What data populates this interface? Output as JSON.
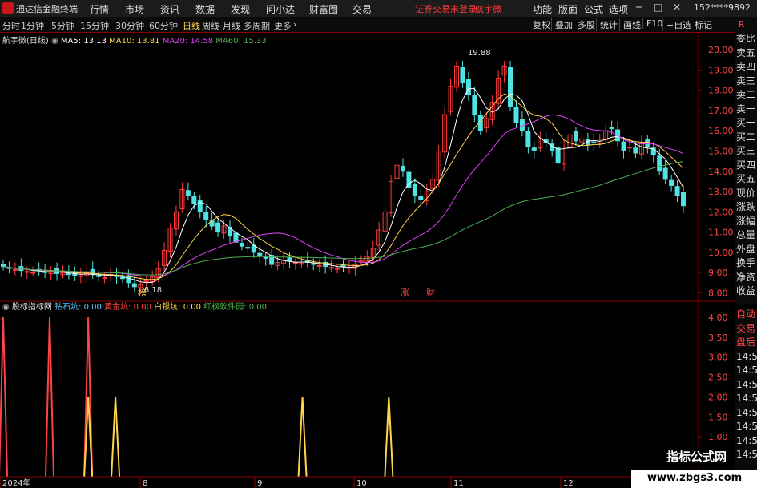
{
  "app": {
    "name": "通达信金融终端"
  },
  "menu": [
    "行情",
    "市场",
    "资讯",
    "数据",
    "发现",
    "问小达",
    "财富圈",
    "交易"
  ],
  "status": {
    "warning": "证券交易未登录",
    "stock_short": "航宇微"
  },
  "right_menu": [
    "功能",
    "版面",
    "公式",
    "选项"
  ],
  "account": "152****9892",
  "periods": [
    "分时",
    "1分钟",
    "5分钟",
    "15分钟",
    "30分钟",
    "60分钟",
    "日线",
    "周线",
    "月线",
    "多周期",
    "更多"
  ],
  "active_period": "日线",
  "tools": [
    "复权",
    "叠加",
    "多股",
    "统计",
    "画线",
    "F10",
    "+自选",
    "标记"
  ],
  "main": {
    "title": "航宇微(日线)",
    "ma": [
      {
        "label": "MA5: 13.13",
        "color": "#ffffff"
      },
      {
        "label": "MA10: 13.81",
        "color": "#ffd54a"
      },
      {
        "label": "MA20: 14.58",
        "color": "#e040fb"
      },
      {
        "label": "MA60: 15.33",
        "color": "#4caf50"
      }
    ],
    "high_label": "19.88",
    "low_label": "8.18",
    "markers": [
      "榜",
      "涨",
      "财"
    ]
  },
  "indicator": {
    "title": "股标指标网",
    "items": [
      {
        "label": "钻石坑: 0.00",
        "color": "#4fc3f7"
      },
      {
        "label": "黄金坑: 0.00",
        "color": "#ff4444"
      },
      {
        "label": "白银坑: 0.00",
        "color": "#ffd54a"
      },
      {
        "label": "红枫软件园: 0.00",
        "color": "#4caf50"
      }
    ]
  },
  "price_axis": [
    "20.00",
    "19.00",
    "18.00",
    "17.00",
    "16.00",
    "15.00",
    "14.00",
    "13.00",
    "12.00",
    "11.00",
    "10.00",
    "9.00",
    "8.00"
  ],
  "ind_axis": [
    "4.00",
    "3.50",
    "3.00",
    "2.50",
    "2.00",
    "1.50",
    "1.00"
  ],
  "date_axis": [
    "2024年",
    "8",
    "9",
    "10",
    "11",
    "12"
  ],
  "side_labels": [
    "委比",
    "卖五",
    "卖四",
    "卖三",
    "卖二",
    "卖一",
    "买一",
    "买二",
    "买三",
    "买四",
    "买五",
    "现价",
    "涨跌",
    "涨幅",
    "总量",
    "外盘",
    "换手",
    "净资",
    "收益"
  ],
  "side_labels2": [
    "自动",
    "交易",
    "盘后",
    "14:56",
    "14:56",
    "14:56",
    "14:56",
    "14:56",
    "14:56",
    "14:56",
    "14:56"
  ],
  "watermark": {
    "title": "指标公式网",
    "url": "www.zbgs3.com"
  },
  "chart_data": {
    "type": "candlestick",
    "ylim": [
      7.7,
      20.4
    ],
    "closes": [
      9.3,
      9.2,
      9.15,
      9.1,
      9.05,
      9.0,
      9.1,
      9.0,
      9.05,
      8.95,
      9.0,
      8.9,
      8.85,
      8.9,
      9.0,
      8.9,
      8.8,
      8.75,
      8.9,
      8.8,
      8.7,
      8.5,
      8.3,
      8.4,
      8.6,
      8.8,
      9.2,
      10.1,
      11.2,
      12.0,
      13.1,
      12.8,
      12.4,
      12.0,
      11.6,
      11.3,
      11.0,
      11.3,
      10.8,
      10.5,
      10.3,
      10.2,
      10.0,
      9.8,
      9.7,
      9.4,
      9.5,
      9.6,
      9.55,
      9.5,
      9.45,
      9.5,
      9.4,
      9.35,
      9.3,
      9.25,
      9.2,
      9.3,
      9.25,
      9.4,
      9.6,
      9.8,
      10.2,
      11.1,
      12.0,
      13.5,
      14.3,
      14.0,
      13.2,
      12.8,
      12.6,
      13.0,
      13.6,
      15.0,
      16.8,
      18.2,
      19.2,
      18.4,
      17.8,
      16.8,
      16.0,
      16.6,
      17.4,
      18.6,
      19.2,
      17.2,
      16.4,
      16.0,
      15.2,
      15.0,
      15.6,
      15.4,
      15.0,
      14.4,
      15.2,
      15.8,
      15.5,
      15.6,
      15.3,
      15.4,
      15.6,
      16.0,
      16.1,
      15.5,
      15.0,
      15.2,
      14.9,
      15.4,
      15.2,
      14.8,
      14.0,
      13.6,
      13.3,
      12.8,
      12.3
    ],
    "ma60_end": 15.33,
    "signals": [
      {
        "x": 0.07,
        "value": 4.0,
        "color": "#ff4444"
      },
      {
        "x": 0.0,
        "value": 4.0,
        "color": "#ff4444"
      },
      {
        "x": 0.125,
        "value": 4.0,
        "color": "#ff4444"
      },
      {
        "x": 0.125,
        "value": 2.0,
        "color": "#ffd54a"
      },
      {
        "x": 0.165,
        "value": 2.0,
        "color": "#ffd54a"
      },
      {
        "x": 0.44,
        "value": 2.0,
        "color": "#ffd54a"
      },
      {
        "x": 0.567,
        "value": 2.0,
        "color": "#ffd54a"
      }
    ]
  }
}
